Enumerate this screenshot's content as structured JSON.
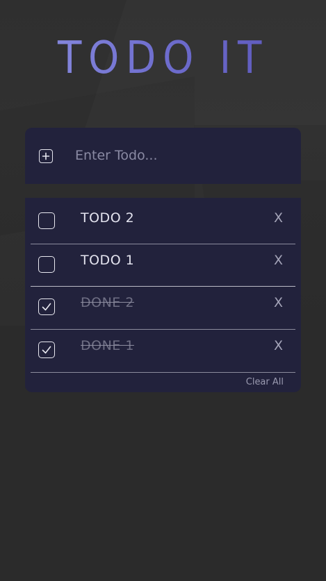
{
  "app": {
    "title": "TODO IT"
  },
  "input": {
    "placeholder": "Enter Todo...",
    "value": "",
    "add_icon": "plus-square-icon"
  },
  "todos": [
    {
      "text": "TODO 2",
      "done": false,
      "delete_label": "X"
    },
    {
      "text": "TODO 1",
      "done": false,
      "delete_label": "X"
    },
    {
      "text": "DONE 2",
      "done": true,
      "delete_label": "X"
    },
    {
      "text": "DONE 1",
      "done": true,
      "delete_label": "X"
    }
  ],
  "footer": {
    "clear_all_label": "Clear All"
  },
  "colors": {
    "background": "#2b2b2b",
    "card": "#22223c",
    "title_gradient_start": "#8b8ee0",
    "title_gradient_end": "#5b56b8",
    "done_text": "#6f6f84"
  }
}
